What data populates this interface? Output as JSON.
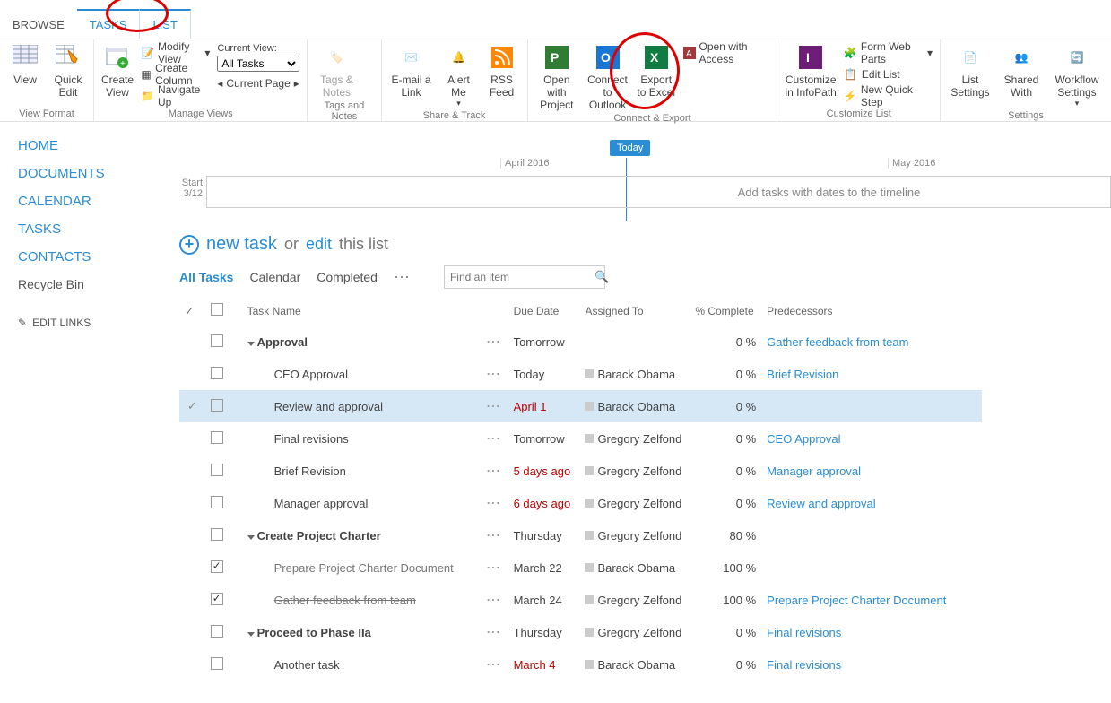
{
  "tabs": {
    "browse": "BROWSE",
    "tasks": "TASKS",
    "list": "LIST"
  },
  "ribbon": {
    "view": "View",
    "quick_edit": "Quick Edit",
    "view_format": "View Format",
    "create_view": "Create View",
    "modify_view": "Modify View",
    "create_column": "Create Column",
    "navigate_up": "Navigate Up",
    "current_view": "Current View:",
    "all_tasks": "All Tasks",
    "current_page": "Current Page",
    "manage_views": "Manage Views",
    "tags_notes": "Tags & Notes",
    "tags_notes_g": "Tags and Notes",
    "email_link": "E-mail a Link",
    "alert_me": "Alert Me",
    "rss_feed": "RSS Feed",
    "share_track": "Share & Track",
    "open_project": "Open with Project",
    "connect_outlook": "Connect to Outlook",
    "export_excel": "Export to Excel",
    "open_access": "Open with Access",
    "connect_export": "Connect & Export",
    "customize_infopath": "Customize in InfoPath",
    "form_web_parts": "Form Web Parts",
    "edit_list": "Edit List",
    "new_quick_step": "New Quick Step",
    "customize_list": "Customize List",
    "list_settings": "List Settings",
    "shared_with": "Shared With",
    "workflow_settings": "Workflow Settings",
    "settings": "Settings"
  },
  "sidebar": {
    "home": "HOME",
    "documents": "DOCUMENTS",
    "calendar": "CALENDAR",
    "tasks": "TASKS",
    "contacts": "CONTACTS",
    "recycle": "Recycle Bin",
    "edit_links": "EDIT LINKS"
  },
  "timeline": {
    "today": "Today",
    "month1": "April 2016",
    "month2": "May 2016",
    "start_label": "Start",
    "start_date": "3/12",
    "hint": "Add tasks with dates to the timeline"
  },
  "list": {
    "new_task": "new task",
    "or": "or",
    "edit": "edit",
    "this_list": "this list",
    "view_all": "All Tasks",
    "view_cal": "Calendar",
    "view_comp": "Completed",
    "search_ph": "Find an item"
  },
  "cols": {
    "name": "Task Name",
    "due": "Due Date",
    "assigned": "Assigned To",
    "pct": "% Complete",
    "pred": "Predecessors"
  },
  "rows": [
    {
      "indent": 0,
      "caret": true,
      "bold": true,
      "done": false,
      "name": "Approval",
      "due": "Tomorrow",
      "overdue": false,
      "assignee": "",
      "pct": "0 %",
      "pred": "Gather feedback from team",
      "selected": false,
      "check": false
    },
    {
      "indent": 1,
      "caret": false,
      "bold": false,
      "done": false,
      "name": "CEO Approval",
      "due": "Today",
      "overdue": false,
      "assignee": "Barack Obama",
      "pct": "0 %",
      "pred": "Brief Revision",
      "selected": false,
      "check": false
    },
    {
      "indent": 1,
      "caret": false,
      "bold": false,
      "done": false,
      "name": "Review and approval",
      "due": "April 1",
      "overdue": true,
      "assignee": "Barack Obama",
      "pct": "0 %",
      "pred": "",
      "selected": true,
      "check": false,
      "checkmark": true
    },
    {
      "indent": 1,
      "caret": false,
      "bold": false,
      "done": false,
      "name": "Final revisions",
      "due": "Tomorrow",
      "overdue": false,
      "assignee": "Gregory Zelfond",
      "pct": "0 %",
      "pred": "CEO Approval",
      "selected": false,
      "check": false
    },
    {
      "indent": 1,
      "caret": false,
      "bold": false,
      "done": false,
      "name": "Brief Revision",
      "due": "5 days ago",
      "overdue": true,
      "assignee": "Gregory Zelfond",
      "pct": "0 %",
      "pred": "Manager approval",
      "selected": false,
      "check": false
    },
    {
      "indent": 1,
      "caret": false,
      "bold": false,
      "done": false,
      "name": "Manager approval",
      "due": "6 days ago",
      "overdue": true,
      "assignee": "Gregory Zelfond",
      "pct": "0 %",
      "pred": "Review and approval",
      "selected": false,
      "check": false
    },
    {
      "indent": 0,
      "caret": true,
      "bold": true,
      "done": false,
      "name": "Create Project Charter",
      "due": "Thursday",
      "overdue": false,
      "assignee": "Gregory Zelfond",
      "pct": "80 %",
      "pred": "",
      "selected": false,
      "check": false
    },
    {
      "indent": 1,
      "caret": false,
      "bold": false,
      "done": true,
      "name": "Prepare Project Charter Document",
      "due": "March 22",
      "overdue": false,
      "assignee": "Barack Obama",
      "pct": "100 %",
      "pred": "",
      "selected": false,
      "check": true
    },
    {
      "indent": 1,
      "caret": false,
      "bold": false,
      "done": true,
      "name": "Gather feedback from team",
      "due": "March 24",
      "overdue": false,
      "assignee": "Gregory Zelfond",
      "pct": "100 %",
      "pred": "Prepare Project Charter Document",
      "selected": false,
      "check": true
    },
    {
      "indent": 0,
      "caret": true,
      "bold": true,
      "done": false,
      "name": "Proceed to Phase IIa",
      "due": "Thursday",
      "overdue": false,
      "assignee": "Gregory Zelfond",
      "pct": "0 %",
      "pred": "Final revisions",
      "selected": false,
      "check": false
    },
    {
      "indent": 1,
      "caret": false,
      "bold": false,
      "done": false,
      "name": "Another task",
      "due": "March 4",
      "overdue": true,
      "assignee": "Barack Obama",
      "pct": "0 %",
      "pred": "Final revisions",
      "selected": false,
      "check": false
    }
  ]
}
